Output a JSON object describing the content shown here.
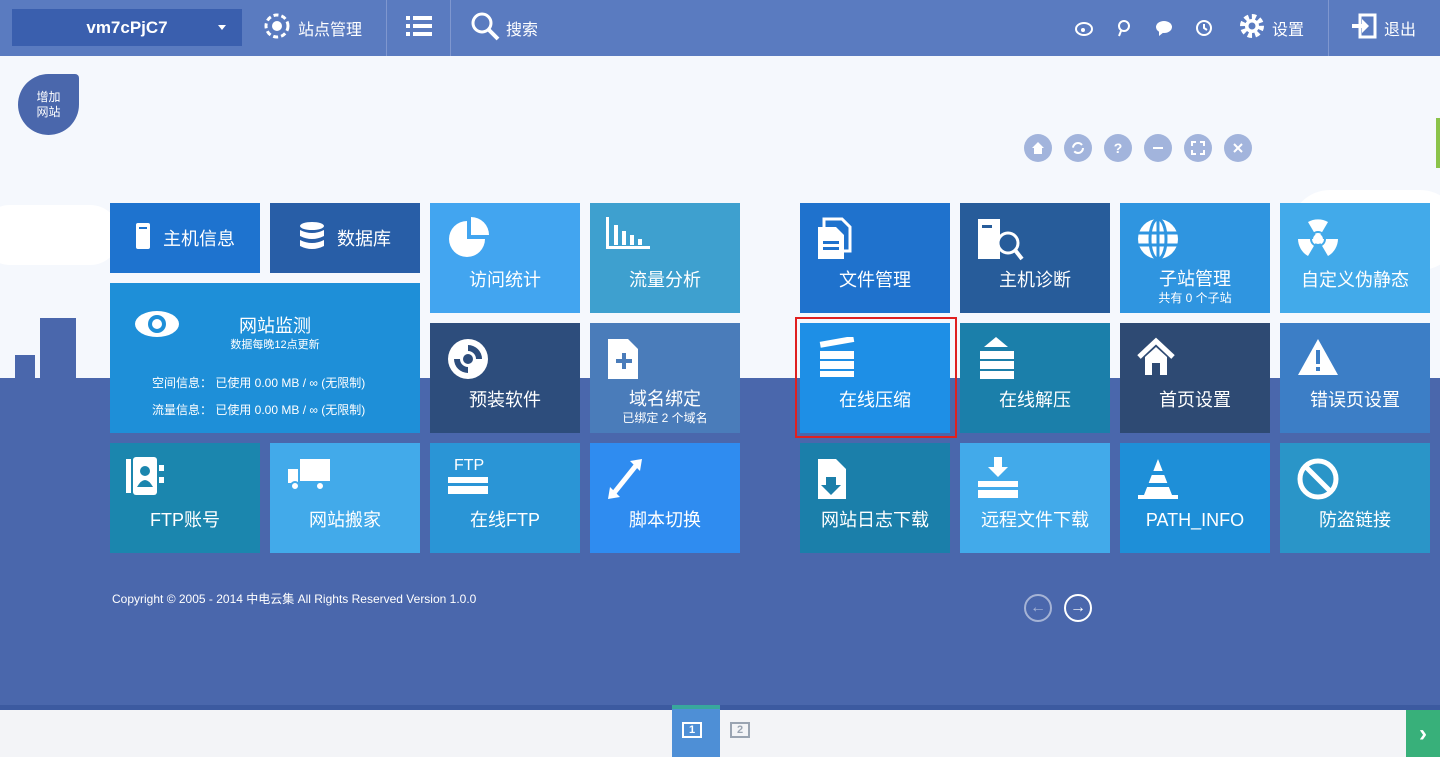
{
  "topbar": {
    "site_name": "vm7cPjC7",
    "site_manage": "站点管理",
    "search": "搜索",
    "settings": "设置",
    "logout": "退出"
  },
  "add_site": {
    "line1": "增加",
    "line2": "网站"
  },
  "controls": [
    "home-icon",
    "refresh-icon",
    "help-icon",
    "minimize-icon",
    "fullscreen-icon",
    "close-icon"
  ],
  "tiles": {
    "host_info": "主机信息",
    "database": "数据库",
    "visit_stats": "访问统计",
    "traffic": "流量分析",
    "monitor_title": "网站监测",
    "monitor_sub": "数据每晚12点更新",
    "space_info": "空间信息： 已使用 0.00 MB / ∞ (无限制)",
    "flow_info": "流量信息： 已使用 0.00 MB / ∞ (无限制)",
    "preinstall": "预装软件",
    "domain_bind": "域名绑定",
    "domain_sub": "已绑定 2 个域名",
    "ftp_account": "FTP账号",
    "site_move": "网站搬家",
    "online_ftp": "在线FTP",
    "ftp_badge": "FTP",
    "script_switch": "脚本切换",
    "file_manage": "文件管理",
    "host_diag": "主机诊断",
    "subsite": "子站管理",
    "subsite_sub": "共有 0 个子站",
    "rewrite": "自定义伪静态",
    "compress": "在线压缩",
    "decompress": "在线解压",
    "homepage": "首页设置",
    "errorpage": "错误页设置",
    "site_log": "网站日志下载",
    "remote_dl": "远程文件下载",
    "path_info": "PATH_INFO",
    "anti_leech": "防盗链接"
  },
  "footer": {
    "copyright": "Copyright © 2005 - 2014 中电云集 All Rights Reserved  Version 1.0.0"
  },
  "pager": {
    "page1": "1",
    "page2": "2"
  },
  "colors": {
    "topbar": "#5a7bc0",
    "land": "#4a67ac",
    "tile_blue": "#1e8fd8",
    "tile_dark": "#2f5d9e",
    "tile_light": "#42a5f0",
    "tile_teal": "#1b86ae",
    "highlight": "#e02020"
  }
}
